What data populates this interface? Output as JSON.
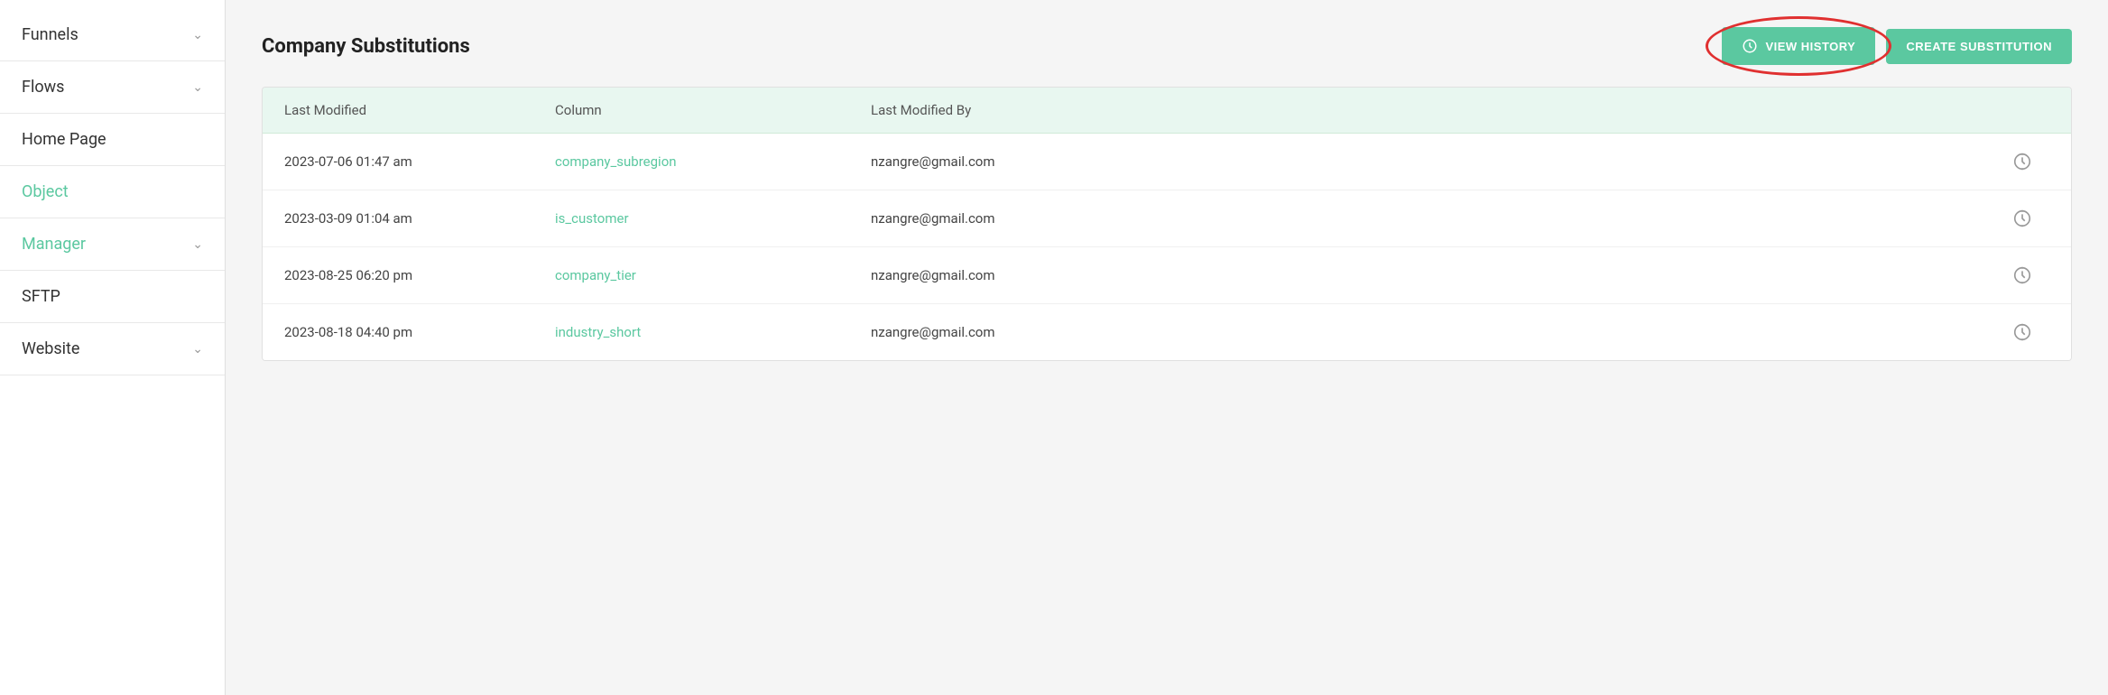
{
  "sidebar": {
    "items": [
      {
        "label": "Funnels",
        "hasChevron": true,
        "active": false
      },
      {
        "label": "Flows",
        "hasChevron": true,
        "active": false
      },
      {
        "label": "Home Page",
        "hasChevron": false,
        "active": false
      },
      {
        "label": "Object",
        "hasChevron": false,
        "active": true
      },
      {
        "label": "Manager",
        "hasChevron": true,
        "active": true
      },
      {
        "label": "SFTP",
        "hasChevron": false,
        "active": false
      },
      {
        "label": "Website",
        "hasChevron": true,
        "active": false
      }
    ]
  },
  "header": {
    "title": "Company Substitutions",
    "view_history_label": "VIEW HISTORY",
    "create_substitution_label": "CREATE SUBSTITUTION"
  },
  "table": {
    "columns": [
      {
        "label": "Last Modified"
      },
      {
        "label": "Column"
      },
      {
        "label": "Last Modified By"
      },
      {
        "label": ""
      }
    ],
    "rows": [
      {
        "last_modified": "2023-07-06 01:47 am",
        "column": "company_subregion",
        "last_modified_by": "nzangre@gmail.com"
      },
      {
        "last_modified": "2023-03-09 01:04 am",
        "column": "is_customer",
        "last_modified_by": "nzangre@gmail.com"
      },
      {
        "last_modified": "2023-08-25 06:20 pm",
        "column": "company_tier",
        "last_modified_by": "nzangre@gmail.com"
      },
      {
        "last_modified": "2023-08-18 04:40 pm",
        "column": "industry_short",
        "last_modified_by": "nzangre@gmail.com"
      }
    ]
  }
}
